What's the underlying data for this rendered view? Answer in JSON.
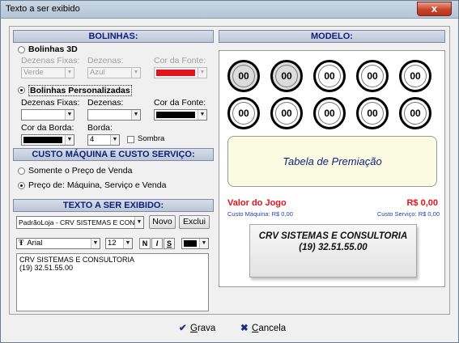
{
  "window": {
    "title": "Texto a ser exibido",
    "close": "x"
  },
  "bolinhas": {
    "header": "BOLINHAS:",
    "opt_3d": "Bolinhas 3D",
    "dezenas_fixas_label": "Dezenas Fixas:",
    "dezenas_label": "Dezenas:",
    "cor_fonte_label": "Cor da Fonte:",
    "d3_fixas_value": "Verde",
    "d3_dezenas_value": "Azul",
    "d3_fonte_color": "#e2141b",
    "opt_pers": "Bolinhas Personalizadas",
    "pers_fixas_value": "",
    "pers_dezenas_value": "",
    "pers_fonte_color": "#000000",
    "cor_borda_label": "Cor da Borda:",
    "borda_label": "Borda:",
    "borda_value": "4",
    "sombra_label": "Sombra",
    "borda_color": "#000000"
  },
  "custo": {
    "header": "CUSTO MÁQUINA E CUSTO SERVIÇO:",
    "opt_venda": "Somente o Preço de Venda",
    "opt_todos": "Preço de: Máquina, Serviço e Venda"
  },
  "texto": {
    "header": "TEXTO A SER EXIBIDO:",
    "preset_value": "PadrãoLoja - CRV SISTEMAS E CONS",
    "novo": "Novo",
    "exclui": "Exclui",
    "font_name": "Arial",
    "font_size": "12",
    "bold": "N",
    "italic": "I",
    "underline": "S",
    "text_color": "#000000",
    "line1": "CRV SISTEMAS E CONSULTORIA",
    "line2": "(19) 32.51.55.00"
  },
  "modelo": {
    "header": "MODELO:",
    "balls": [
      "00",
      "00",
      "00",
      "00",
      "00",
      "00",
      "00",
      "00",
      "00",
      "00"
    ],
    "tabela": "Tabela de Premiação",
    "valor_label": "Valor do Jogo",
    "valor_value": "R$ 0,00",
    "custo_maquina": "Custo Máquina: R$ 0,00",
    "custo_servico": "Custo Serviço: R$ 0,00",
    "crv_line1": "CRV SISTEMAS E CONSULTORIA",
    "crv_line2": "(19) 32.51.55.00"
  },
  "footer": {
    "grava_prefix": "G",
    "grava_rest": "rava",
    "cancela_prefix": "C",
    "cancela_rest": "ancela"
  },
  "colors": {
    "header_text": "#0b1f7a",
    "valor_red": "#e2141b",
    "custo_blue": "#1f3fb5"
  }
}
